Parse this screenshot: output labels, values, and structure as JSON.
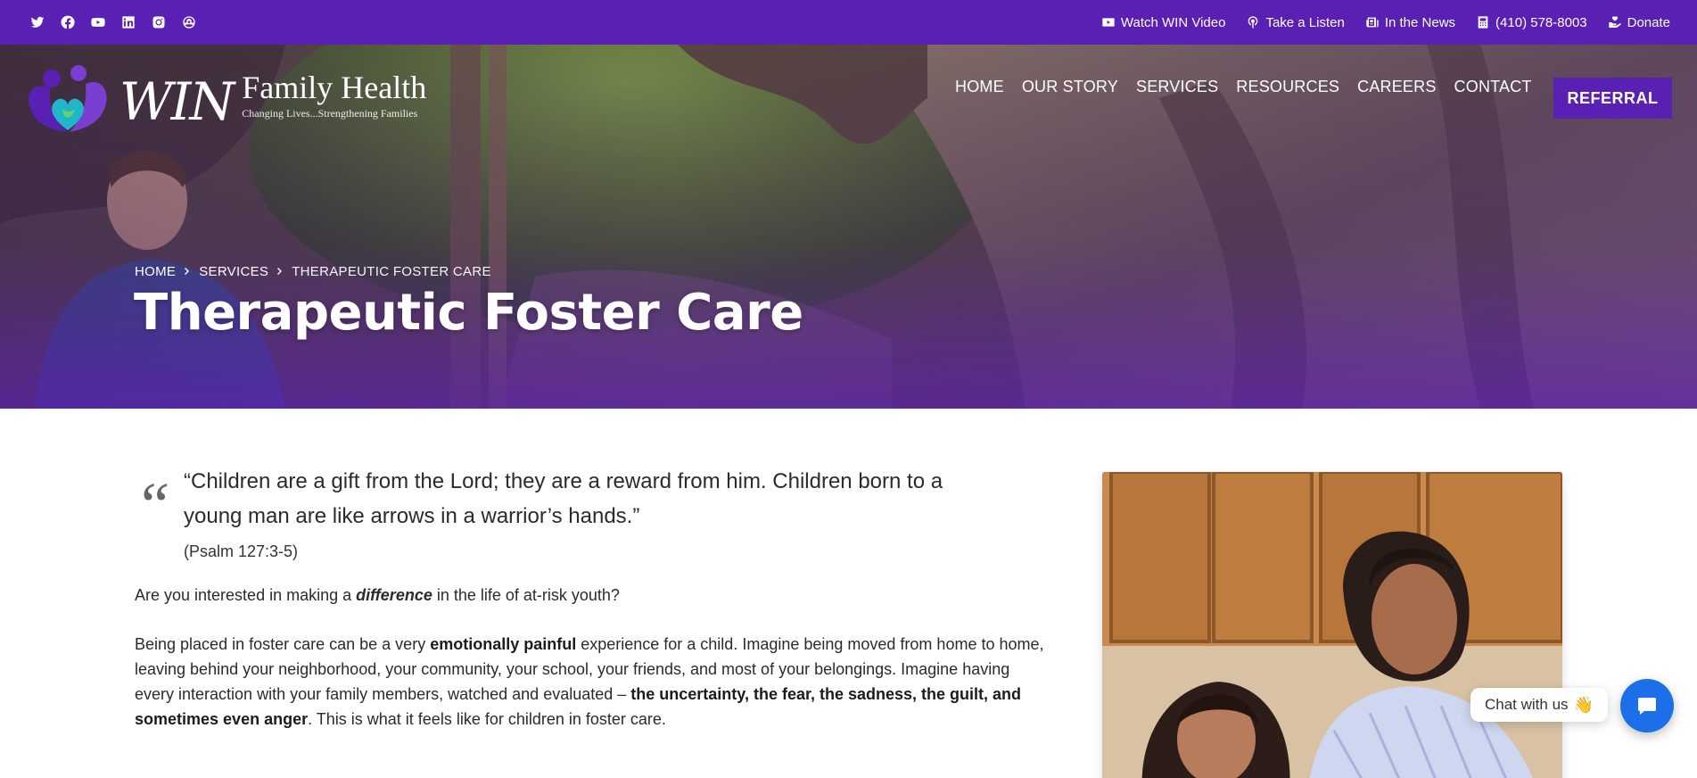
{
  "topbar": {
    "socials": [
      {
        "name": "twitter-icon"
      },
      {
        "name": "facebook-icon"
      },
      {
        "name": "youtube-icon"
      },
      {
        "name": "linkedin-icon"
      },
      {
        "name": "instagram-icon"
      },
      {
        "name": "podcast-icon"
      }
    ],
    "links": [
      {
        "label": "Watch WIN Video",
        "icon": "video-icon"
      },
      {
        "label": "Take a Listen",
        "icon": "podcast-icon"
      },
      {
        "label": "In the News",
        "icon": "newspaper-icon"
      },
      {
        "label": "(410) 578-8003",
        "icon": "phone-icon"
      },
      {
        "label": "Donate",
        "icon": "donate-hands-icon"
      }
    ]
  },
  "logo": {
    "win": "WIN",
    "family_health": "Family Health",
    "tagline": "Changing Lives...Strengthening Families"
  },
  "nav": {
    "items": [
      "HOME",
      "OUR STORY",
      "SERVICES",
      "RESOURCES",
      "CAREERS",
      "CONTACT"
    ],
    "referral": "REFERRAL"
  },
  "hero": {
    "breadcrumb": [
      "HOME",
      "SERVICES",
      "THERAPEUTIC FOSTER CARE"
    ],
    "title": "Therapeutic Foster Care"
  },
  "content": {
    "quote_mark": "“",
    "quote": "“Children are a gift from the Lord; they are a reward from him. Children born to a young man are like arrows in a warrior’s hands.”",
    "citation": "(Psalm 127:3-5)",
    "p1": {
      "before": "Are you interested in making a ",
      "emph": "difference",
      "after": " in the life of at-risk youth?"
    },
    "p2": {
      "a": "Being placed in foster care can be a very ",
      "b": "emotionally painful",
      "c": " experience for a child. Imagine being moved from home to home, leaving behind your neighborhood, your community, your school, your friends, and most of your belongings. Imagine having every interaction with your family members, watched and evaluated – ",
      "d": "the uncertainty, the fear, the sadness, the guilt, and sometimes even anger",
      "e": ". This is what it feels like for children in foster care."
    }
  },
  "chat": {
    "label": "Chat with us",
    "wave": "👋"
  },
  "colors": {
    "brand_purple": "#5a1fb3",
    "chat_blue": "#1c6fe8"
  }
}
